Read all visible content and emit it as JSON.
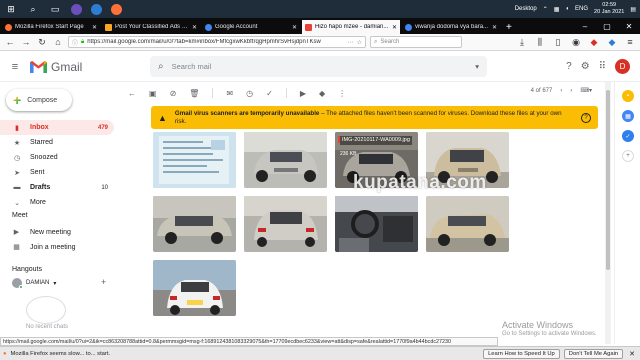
{
  "taskbar": {
    "desktop_label": "Desktop",
    "lang": "ENG",
    "time": "02:59",
    "date": "20 Jan 2021"
  },
  "tabs": [
    {
      "title": "Mozilla Firefox Start Page",
      "favicon_color": "#ff7139",
      "active": false
    },
    {
      "title": "Post Your Classified Ads O...",
      "favicon_color": "#f9a825",
      "active": false
    },
    {
      "title": "Google Account",
      "favicon_color": "#4285f4",
      "active": false
    },
    {
      "title": "Hizo hapo mzee - damian...",
      "favicon_color": "#ea4335",
      "active": true
    },
    {
      "title": "viwanja dodoma vya bara...",
      "favicon_color": "#4285f4",
      "active": false
    }
  ],
  "navbar": {
    "url": "https://mail.google.com/mail/u/0/?tab=km#inbox/FMfcgxwKkbftrqgHpmhrSvHsjdpnTKsw",
    "search_placeholder": "Search"
  },
  "gmail": {
    "logo_text": "Gmail",
    "search_placeholder": "Search mail",
    "avatar_letter": "D",
    "compose_label": "Compose",
    "nav": [
      {
        "label": "Inbox",
        "count": "479",
        "icon": "inbox-icon",
        "active": true,
        "bold": true
      },
      {
        "label": "Starred",
        "count": "",
        "icon": "star-icon",
        "active": false,
        "bold": false
      },
      {
        "label": "Snoozed",
        "count": "",
        "icon": "clock-icon",
        "active": false,
        "bold": false
      },
      {
        "label": "Sent",
        "count": "",
        "icon": "send-icon",
        "active": false,
        "bold": false
      },
      {
        "label": "Drafts",
        "count": "10",
        "icon": "draft-icon",
        "active": false,
        "bold": true
      },
      {
        "label": "More",
        "count": "",
        "icon": "chevron-down-icon",
        "active": false,
        "bold": false
      }
    ],
    "meet": {
      "title": "Meet",
      "new_meeting": "New meeting",
      "join_meeting": "Join a meeting"
    },
    "hangouts": {
      "title": "Hangouts",
      "user": "DAMIAN",
      "no_recent": "No recent chats"
    },
    "pager": "4 of 677",
    "warning": {
      "title": "Gmail virus scanners are temporarily unavailable",
      "text": " – The attached files haven't been scanned for viruses. Download these files at your own risk."
    },
    "attachments": [
      {
        "kind": "document",
        "name": "",
        "size": ""
      },
      {
        "kind": "car-front-silver",
        "name": "",
        "size": ""
      },
      {
        "kind": "car-front-dark",
        "name": "IMG-20210117-WA0009.jpg",
        "size": "236 KB"
      },
      {
        "kind": "car-front-gold",
        "name": "",
        "size": ""
      },
      {
        "kind": "car-side-silver",
        "name": "",
        "size": ""
      },
      {
        "kind": "car-rear-silver",
        "name": "",
        "size": ""
      },
      {
        "kind": "car-interior",
        "name": "",
        "size": ""
      },
      {
        "kind": "car-side-gold",
        "name": "",
        "size": ""
      },
      {
        "kind": "car-rear-white",
        "name": "",
        "size": ""
      }
    ],
    "watermark": "kupatana.com"
  },
  "windows_notice": {
    "line1": "Activate Windows",
    "line2": "Go to Settings to activate Windows."
  },
  "status_url": "https://mail.google.com/mail/u/0?ui=2&ik=cc863208788attid=0.8&permmsgid=msg-f:1689124381083329075&th=17709ecdbec6233&view=att&disp=safe&realattid=1770f9a4b44bcdc27230",
  "firefox_bar": {
    "message": "Mozilla Firefox seems slow... to... start.",
    "learn_button": "Learn How to Speed It Up",
    "dont_tell_button": "Don't Tell Me Again"
  },
  "colors": {
    "gmail_red": "#d93025",
    "warning_yellow": "#fbbc04",
    "taskbar": "#1f2d3a"
  }
}
